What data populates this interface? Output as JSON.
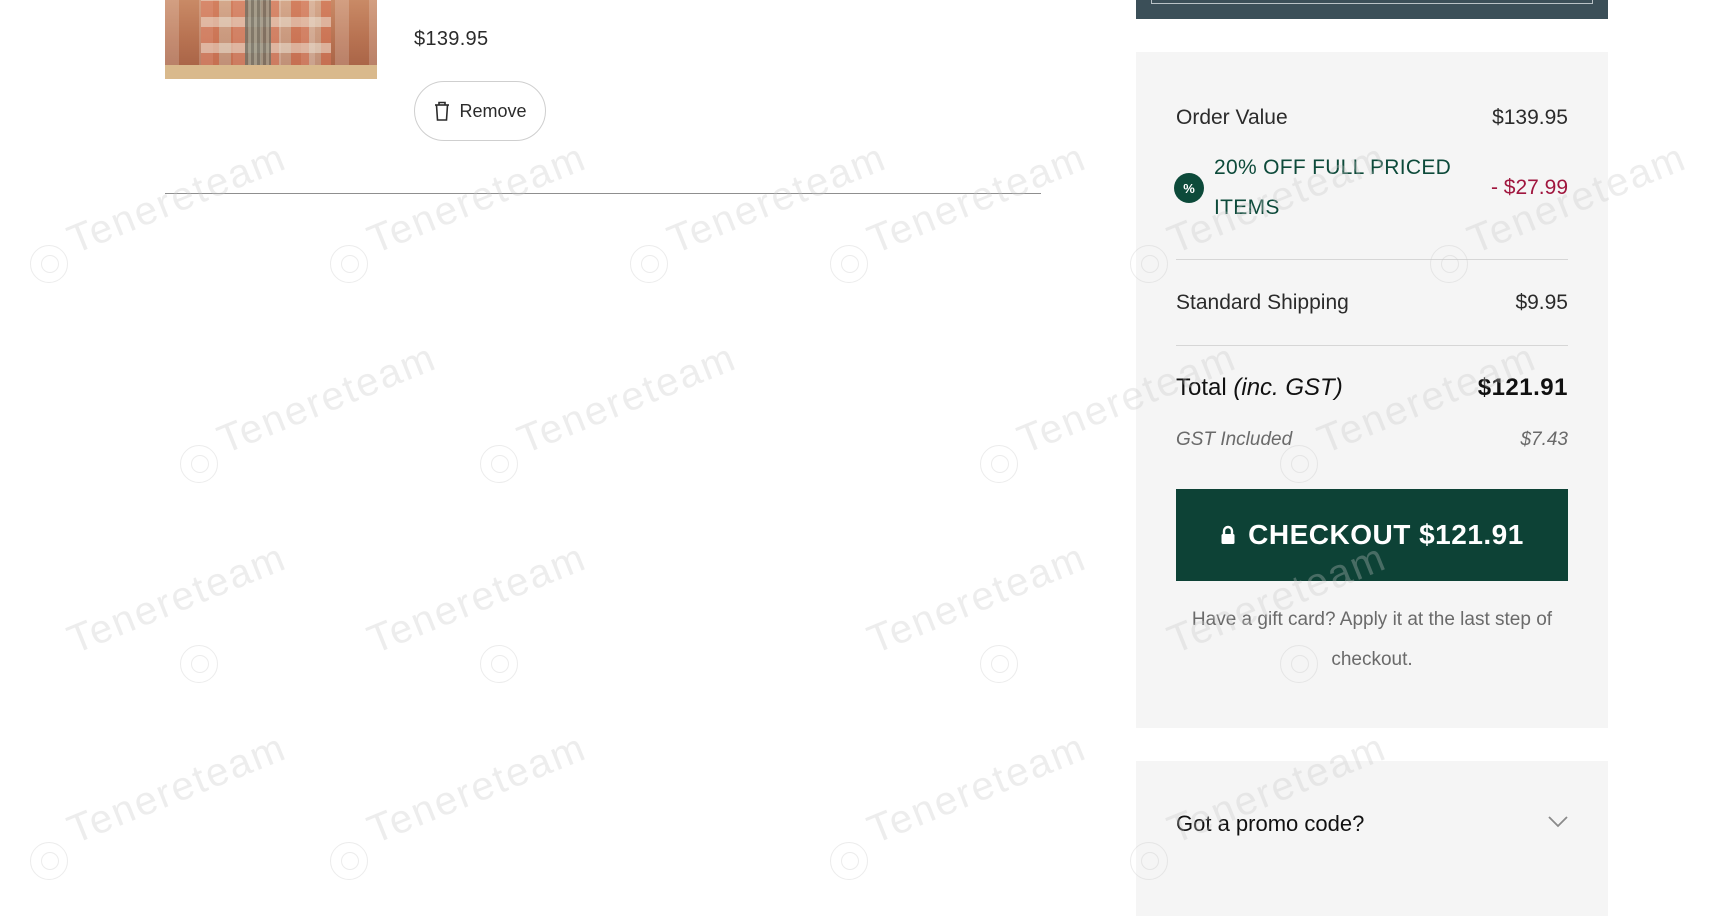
{
  "cart_item": {
    "price": "$139.95",
    "remove_label": "Remove"
  },
  "summary": {
    "order_value_label": "Order Value",
    "order_value": "$139.95",
    "discount_badge": "%",
    "discount_label": "20% OFF FULL PRICED ITEMS",
    "discount_value": "- $27.99",
    "shipping_label": "Standard Shipping",
    "shipping_value": "$9.95",
    "total_label": "Total",
    "total_suffix": "(inc. GST)",
    "total_value": "$121.91",
    "gst_label": "GST Included",
    "gst_value": "$7.43",
    "checkout_label": "CHECKOUT $121.91",
    "gift_note": "Have a gift card? Apply it at the last step of checkout."
  },
  "promo": {
    "label": "Got a promo code?"
  },
  "watermark": {
    "text": "Tenereteam"
  },
  "colors": {
    "brand_green": "#0d4236",
    "discount_red": "#a0163e",
    "panel_bg": "#f5f5f5",
    "top_bar": "#3b4f58"
  },
  "icons": [
    "trash-icon",
    "lock-icon",
    "percent-badge-icon",
    "chevron-down-icon",
    "watermark-logo-icon"
  ]
}
